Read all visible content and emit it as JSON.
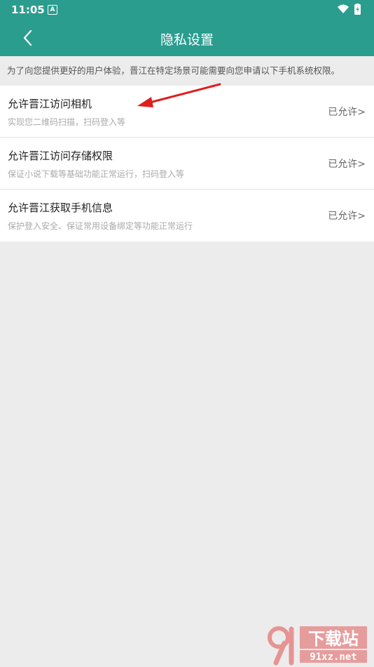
{
  "status_bar": {
    "time": "11:05",
    "notification_glyph": "A"
  },
  "header": {
    "title": "隐私设置",
    "back_icon": "chevron-left-icon"
  },
  "notice": "为了向您提供更好的用户体验，晋江在特定场景可能需要向您申请以下手机系统权限。",
  "permissions": [
    {
      "title": "允许晋江访问相机",
      "desc": "实现您二维码扫描，扫码登入等",
      "status": "已允许>"
    },
    {
      "title": "允许晋江访问存储权限",
      "desc": "保证小说下载等基础功能正常运行，扫码登入等",
      "status": "已允许>"
    },
    {
      "title": "允许晋江获取手机信息",
      "desc": "保护登入安全、保证常用设备绑定等功能正常运行",
      "status": "已允许>"
    }
  ],
  "watermark": {
    "line1": "下载站",
    "line2": "91xz.net"
  },
  "colors": {
    "accent": "#2a9d8f",
    "arrow": "#e11d1d"
  }
}
